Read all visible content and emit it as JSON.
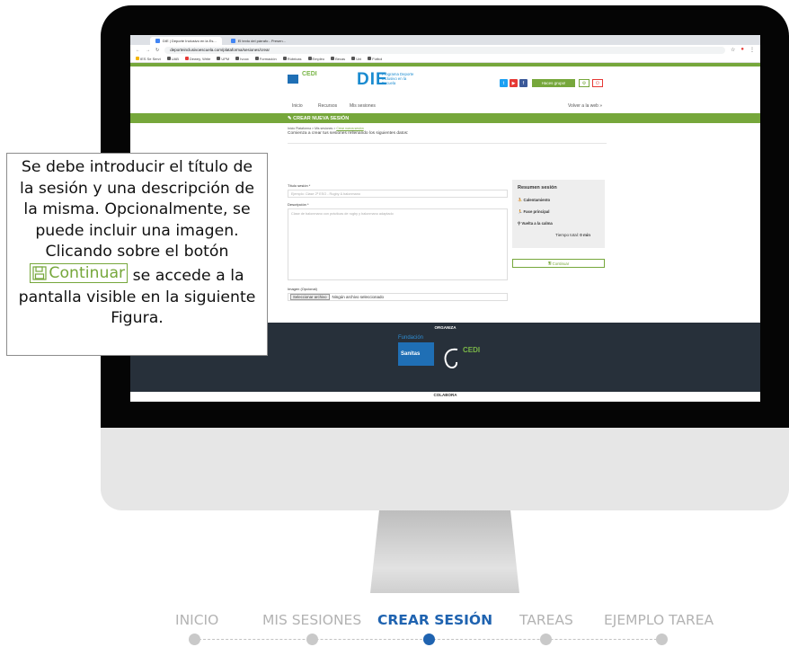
{
  "browser": {
    "tabs": [
      "DIE | Deporte Inclusivo en la Es...",
      "El texto del párrafo - Presen..."
    ],
    "url": "deporteinclusivoescuela.com/plataforma/sesiones/crear",
    "bookmarks": [
      "IES Se Servi",
      "UAB",
      "Dewey, Write",
      "UPM",
      "Ivoox",
      "Formación",
      "Rúbricas",
      "Empleo",
      "Becas",
      "Uni",
      "Fútbol"
    ]
  },
  "site": {
    "logo_cedi": "CEDI",
    "logo_die": "DIE",
    "logo_sub": "Programa Deporte Inclusivo en la Escuela",
    "join_button": "Haces grupo!",
    "nav": {
      "inicio": "Inicio",
      "recursos": "Recursos",
      "mis_sesiones": "Mis sesiones",
      "volver": "Volver a la web »"
    },
    "section_title": "CREAR NUEVA SESIÓN",
    "breadcrumb": {
      "home": "Inicio Plataforma",
      "sessions": "Mis sesiones",
      "current": "Crear nueva sesión"
    },
    "intro": "Comienza a crear tus sesiones rellenando los siguientes datos:",
    "form": {
      "title_label": "Título sesión *",
      "title_placeholder": "Ejemplo: Clase 2º ESO - Rugby & balonmano",
      "desc_label": "Descripción *",
      "desc_placeholder": "Clase de balonmano con prácticas de rugby y balonmano adaptado",
      "image_label": "Imagen (Opcional)",
      "file_button": "Seleccionar archivo",
      "file_status": "Ningún archivo seleccionado"
    },
    "summary": {
      "title": "Resumen sesión",
      "items": [
        "Calentamiento",
        "Fase principal",
        "Vuelta a la calma"
      ],
      "total_label": "Tiempo total:",
      "total_value": "0 min",
      "continue_button": "Continuar"
    },
    "footer": {
      "organiza": "ORGANIZA",
      "fundacion": "Fundación",
      "sanitas": "Sanitas",
      "cedi": "CEDI",
      "colabora": "COLABORA"
    }
  },
  "callout": {
    "text_before": "Se debe introducir el título de la sesión y una descripción de la misma. Opcionalmente, se puede incluir una imagen. Clicando sobre el botón",
    "button_label": "Continuar",
    "text_after": "se accede a la pantalla visible en la siguiente Figura."
  },
  "steps": [
    {
      "label": "INICIO",
      "active": false
    },
    {
      "label": "MIS SESIONES",
      "active": false
    },
    {
      "label": "CREAR SESIÓN",
      "active": true
    },
    {
      "label": "TAREAS",
      "active": false
    },
    {
      "label": "EJEMPLO TAREA",
      "active": false
    }
  ],
  "colors": {
    "accent_green": "#76a73b",
    "accent_blue": "#1f63b0",
    "footer_dark": "#27303a"
  }
}
